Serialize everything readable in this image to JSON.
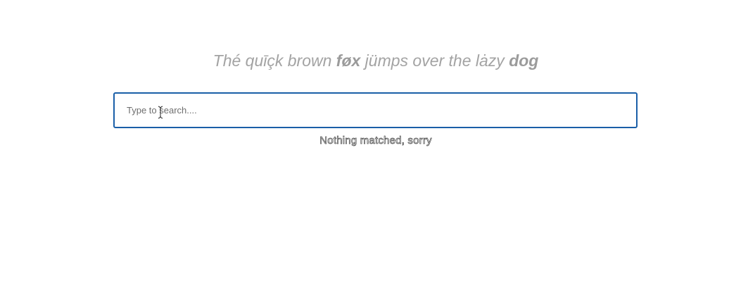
{
  "headline": {
    "part1": "Thé quīçk brown ",
    "bold1": "føx",
    "part2": " jümps over the lȧzy ",
    "bold2": "dog"
  },
  "search": {
    "placeholder": "Type to search....",
    "value": ""
  },
  "results": {
    "empty_message": "Nothing matched, sorry"
  },
  "colors": {
    "accent": "#1a5fa8",
    "headline": "#a3a3a3"
  },
  "icons": {
    "cursor": "text-cursor-icon"
  }
}
